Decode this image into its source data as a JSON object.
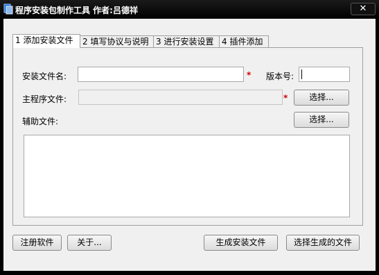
{
  "window": {
    "title": "程序安装包制作工具  作者:吕德祥",
    "close_glyph": "✕"
  },
  "tabs": [
    {
      "label": "1 添加安装文件"
    },
    {
      "label": "2 填写协议与说明"
    },
    {
      "label": "3 进行安装设置"
    },
    {
      "label": "4 插件添加"
    }
  ],
  "form": {
    "install_name_label": "安装文件名:",
    "install_name_value": "",
    "version_label": "版本号:",
    "version_value": "",
    "main_program_label": "主程序文件:",
    "main_program_value": "",
    "aux_files_label": "辅助文件:",
    "required_mark": "*",
    "select_label": "选择..."
  },
  "footer": {
    "register_label": "注册软件",
    "about_label": "关于...",
    "generate_label": "生成安装文件",
    "select_generated_label": "选择生成的文件"
  },
  "colors": {
    "required": "#d00000",
    "frame": "#000000",
    "client": "#f0f0f0"
  }
}
